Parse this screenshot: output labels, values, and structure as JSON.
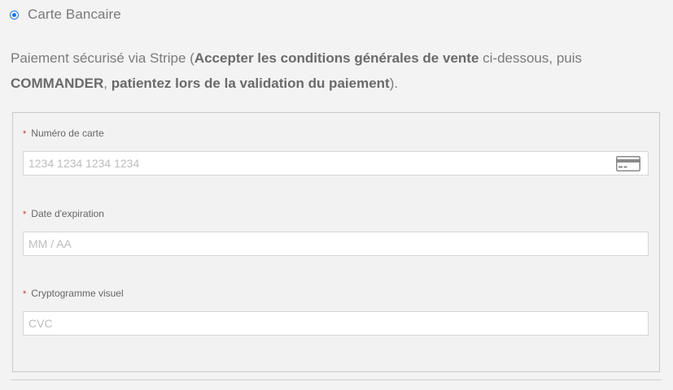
{
  "payment_method": {
    "label": "Carte Bancaire",
    "selected": true,
    "accent_color": "#1a73e8"
  },
  "description": {
    "part1": "Paiement sécurisé via Stripe (",
    "bold1": "Accepter les conditions générales de vente",
    "part2": " ci-dessous, puis ",
    "bold2": "COMMANDER",
    "part3": ", ",
    "bold3": "patientez lors de la validation du paiement",
    "part4": ")."
  },
  "card_form": {
    "required_marker": "*",
    "card_number": {
      "label": "Numéro de carte",
      "placeholder": "1234 1234 1234 1234",
      "value": "",
      "icon": "credit-card-icon"
    },
    "expiry": {
      "label": "Date d'expiration",
      "placeholder": "MM / AA",
      "value": ""
    },
    "cvc": {
      "label": "Cryptogramme visuel",
      "placeholder": "CVC",
      "value": ""
    }
  }
}
